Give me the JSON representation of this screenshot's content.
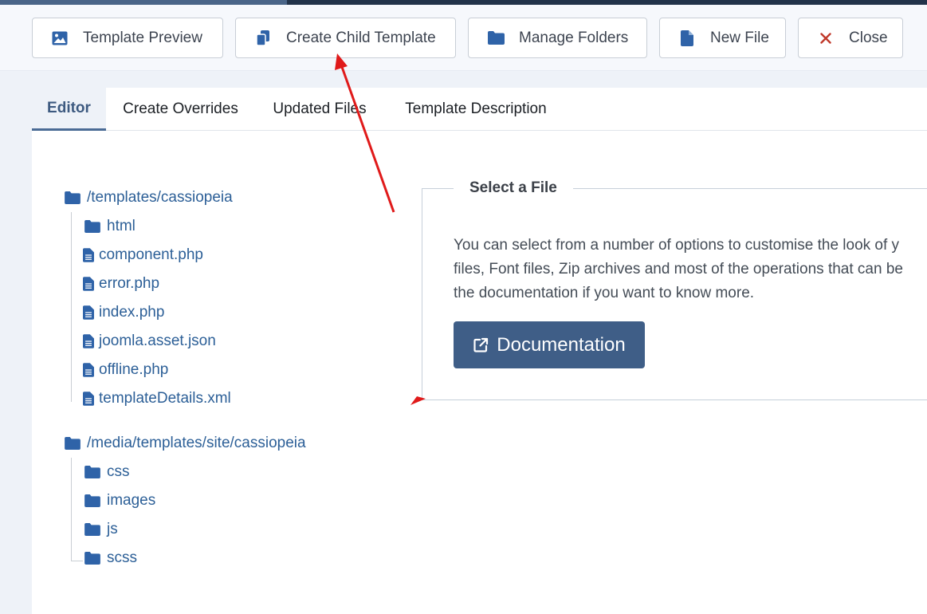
{
  "toolbar": {
    "buttons": [
      {
        "label": "Template Preview",
        "icon": "image-icon"
      },
      {
        "label": "Create Child Template",
        "icon": "copy-icon"
      },
      {
        "label": "Manage Folders",
        "icon": "folder-icon"
      },
      {
        "label": "New File",
        "icon": "file-icon"
      },
      {
        "label": "Close",
        "icon": "close-icon"
      }
    ]
  },
  "tabs": [
    {
      "label": "Editor",
      "active": true
    },
    {
      "label": "Create Overrides",
      "active": false
    },
    {
      "label": "Updated Files",
      "active": false
    },
    {
      "label": "Template Description",
      "active": false
    }
  ],
  "tree": {
    "root1": {
      "label": "/templates/cassiopeia",
      "children": [
        "html",
        "component.php",
        "error.php",
        "index.php",
        "joomla.asset.json",
        "offline.php",
        "templateDetails.xml"
      ]
    },
    "root2": {
      "label": "/media/templates/site/cassiopeia",
      "children": [
        "css",
        "images",
        "js",
        "scss"
      ]
    }
  },
  "select_file": {
    "legend": "Select a File",
    "lines": [
      "You can select from a number of options to customise the look of y",
      "files, Font files, Zip archives and most of the operations that can be",
      "the documentation if you want to know more."
    ],
    "button_label": "Documentation"
  },
  "colors": {
    "link": "#2c5f97",
    "primary_button": "#3f5e87",
    "annotation_arrow": "#e01a1a",
    "close_icon": "#c0392b"
  }
}
